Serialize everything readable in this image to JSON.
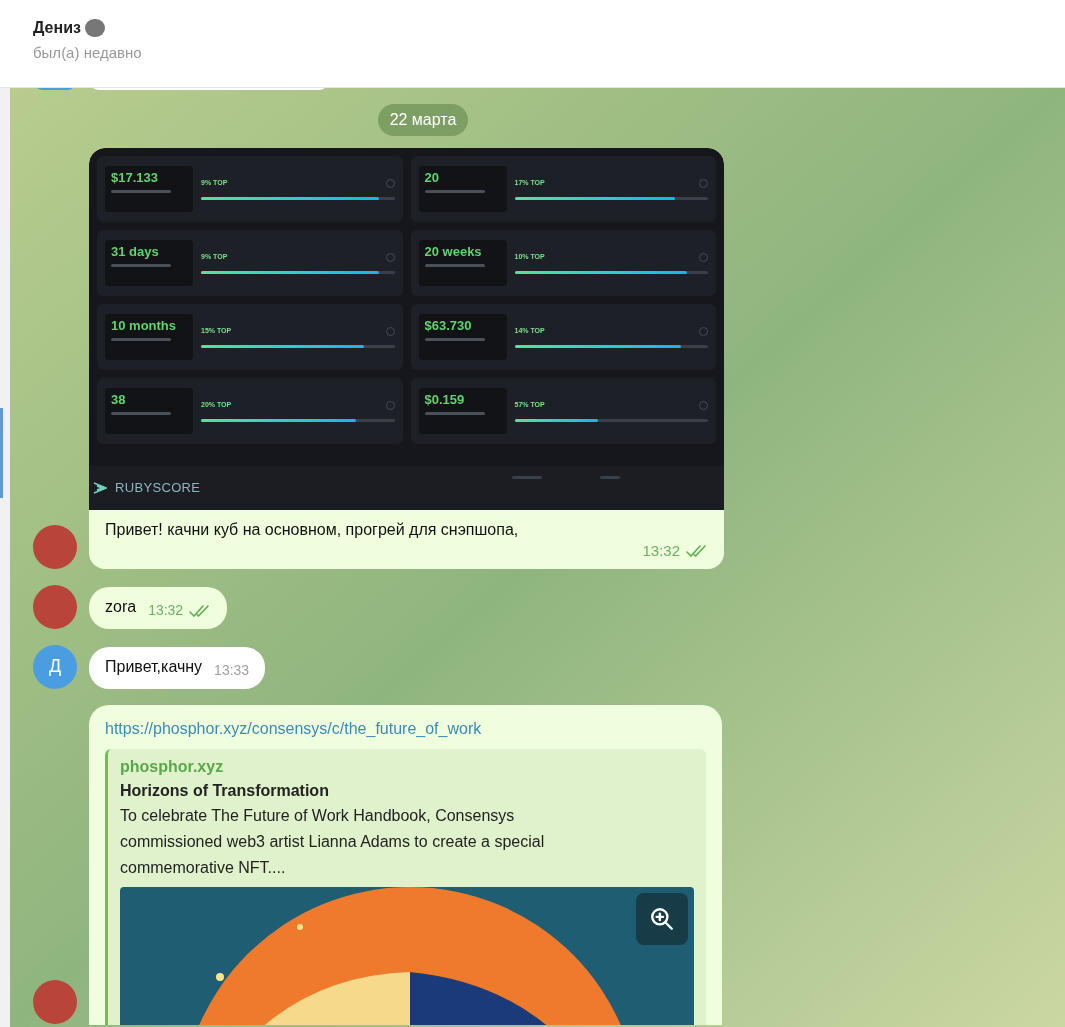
{
  "header": {
    "name": "Дениз",
    "status": "был(а) недавно"
  },
  "date_pill": "22 марта",
  "messages": [
    {
      "kind": "screenshot",
      "outgoing": true,
      "stats": [
        {
          "value": "$17.133",
          "rank": "9% TOP",
          "level": 0.92
        },
        {
          "value": "20",
          "rank": "17% TOP",
          "level": 0.83
        },
        {
          "value": "31 days",
          "rank": "9% TOP",
          "level": 0.92
        },
        {
          "value": "20 weeks",
          "rank": "10% TOP",
          "level": 0.89
        },
        {
          "value": "10 months",
          "rank": "15% TOP",
          "level": 0.84
        },
        {
          "value": "$63.730",
          "rank": "14% TOP",
          "level": 0.86
        },
        {
          "value": "38",
          "rank": "20% TOP",
          "level": 0.8
        },
        {
          "value": "$0.159",
          "rank": "57% TOP",
          "level": 0.43
        }
      ],
      "brand": "RUBYSCORE",
      "text": "Привет! качни куб на основном, прогрей для снэпшопа,",
      "time": "13:32",
      "read": true
    },
    {
      "kind": "text",
      "outgoing": true,
      "text": "zora",
      "time": "13:32",
      "read": true
    },
    {
      "kind": "text",
      "outgoing": false,
      "letter": "Д",
      "text": "Привет,качну",
      "time": "13:33"
    },
    {
      "kind": "link",
      "outgoing": true,
      "url": "https://phosphor.xyz/consensys/c/the_future_of_work",
      "site": "phosphor.xyz",
      "title": "Horizons of Transformation",
      "description": "To celebrate The Future of Work Handbook, Consensys commissioned web3 artist Lianna Adams to create a special commemorative NFT...."
    }
  ]
}
